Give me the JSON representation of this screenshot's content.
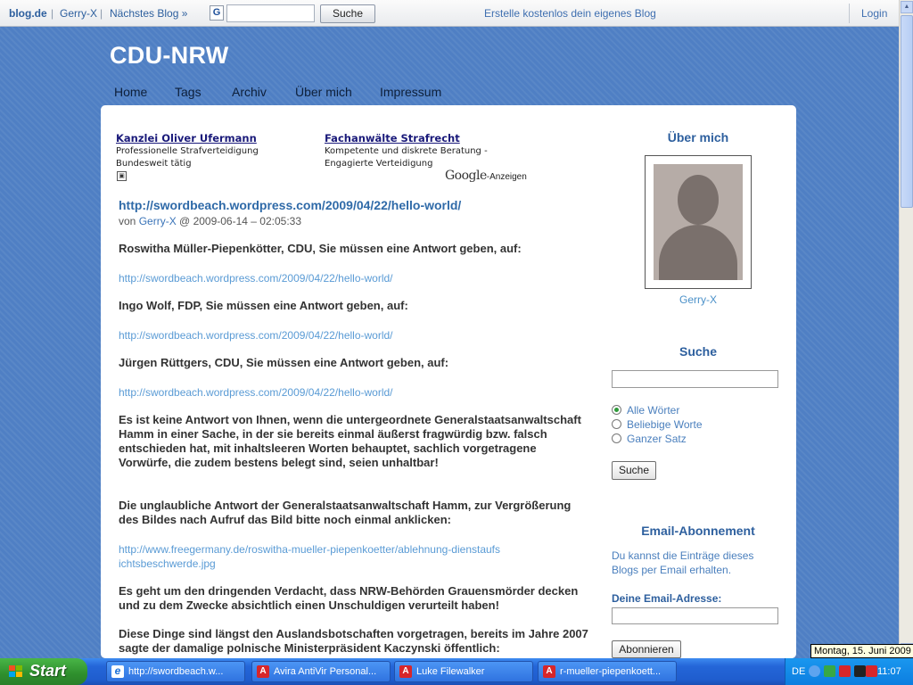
{
  "topbar": {
    "brand": "blog.de",
    "user": "Gerry-X",
    "next_blog": "Nächstes Blog »",
    "search_icon": "google-g-icon",
    "search_button": "Suche",
    "search_value": "",
    "create_blog": "Erstelle kostenlos dein eigenes Blog",
    "login": "Login"
  },
  "blog": {
    "title": "CDU-NRW",
    "nav": [
      "Home",
      "Tags",
      "Archiv",
      "Über mich",
      "Impressum"
    ]
  },
  "ads": {
    "ad1": {
      "title": "Kanzlei Oliver Ufermann",
      "line1": "Professionelle Strafverteidigung",
      "line2": "Bundesweit tätig"
    },
    "ad2": {
      "title": "Fachanwälte Strafrecht",
      "line1": "Kompetente und diskrete Beratung -",
      "line2": "Engagierte Verteidigung"
    },
    "google_word": "Google",
    "suffix": "-Anzeigen"
  },
  "post": {
    "title": "http://swordbeach.wordpress.com/2009/04/22/hello-world/",
    "meta_prefix": "von",
    "author": "Gerry-X",
    "meta_suffix": "@ 2009-06-14 – 02:05:33",
    "paragraphs": [
      "Roswitha Müller-Piepenkötter, CDU, Sie müssen eine Antwort geben, auf:",
      "http://swordbeach.wordpress.com/2009/04/22/hello-world/",
      "Ingo Wolf, FDP, Sie müssen eine Antwort geben, auf:",
      "http://swordbeach.wordpress.com/2009/04/22/hello-world/",
      "Jürgen Rüttgers, CDU, Sie müssen eine Antwort geben, auf:",
      "http://swordbeach.wordpress.com/2009/04/22/hello-world/",
      "Es ist keine Antwort von Ihnen, wenn die untergeordnete Generalstaatsanwaltschaft Hamm in einer Sache, in der sie bereits einmal äußerst fragwürdig bzw. falsch entschieden hat, mit inhaltsleeren Worten behauptet, sachlich vorgetragene Vorwürfe, die zudem bestens belegt sind, seien unhaltbar!",
      "Die unglaubliche Antwort der Generalstaatsanwaltschaft Hamm, zur Vergrößerung des Bildes nach Aufruf das Bild bitte noch einmal anklicken:",
      "http://www.freegermany.de/roswitha-mueller-piepenkoetter/ablehnung-dienstaufsichtsbeschwerde.jpg",
      "Es geht um den dringenden Verdacht, dass NRW-Behörden Grauensmörder decken und zu dem Zwecke absichtlich einen Unschuldigen verurteilt haben!",
      "Diese Dinge sind längst den Auslandsbotschaften vorgetragen, bereits im Jahre 2007 sagte der damalige polnische Ministerpräsident Kaczynski öffentlich:"
    ]
  },
  "sidebar": {
    "about_title": "Über mich",
    "author_name": "Gerry-X",
    "search_title": "Suche",
    "search_value": "",
    "radio_options": [
      "Alle Wörter",
      "Beliebige Worte",
      "Ganzer Satz"
    ],
    "radio_selected": "Alle Wörter",
    "search_button": "Suche",
    "email_title": "Email-Abonnement",
    "email_desc": "Du kannst die Einträge dieses Blogs per Email erhalten.",
    "email_label": "Deine Email-Adresse:",
    "email_value": "",
    "subscribe_button": "Abonnieren"
  },
  "taskbar": {
    "start": "Start",
    "tasks": [
      {
        "label": "http://swordbeach.w...",
        "icon": "internet-explorer-icon"
      },
      {
        "label": "Avira AntiVir Personal...",
        "icon": "avira-icon"
      },
      {
        "label": "Luke Filewalker",
        "icon": "avira-icon"
      },
      {
        "label": "r-mueller-piepenkoett...",
        "icon": "avira-icon"
      }
    ],
    "lang": "DE",
    "clock": "11:07",
    "tooltip": "Montag, 15. Juni 2009"
  },
  "colors": {
    "page_bg": "#4f7fc4",
    "link": "#3a74b8",
    "taskbar": "#2466d8",
    "start": "#2e8f2d"
  }
}
